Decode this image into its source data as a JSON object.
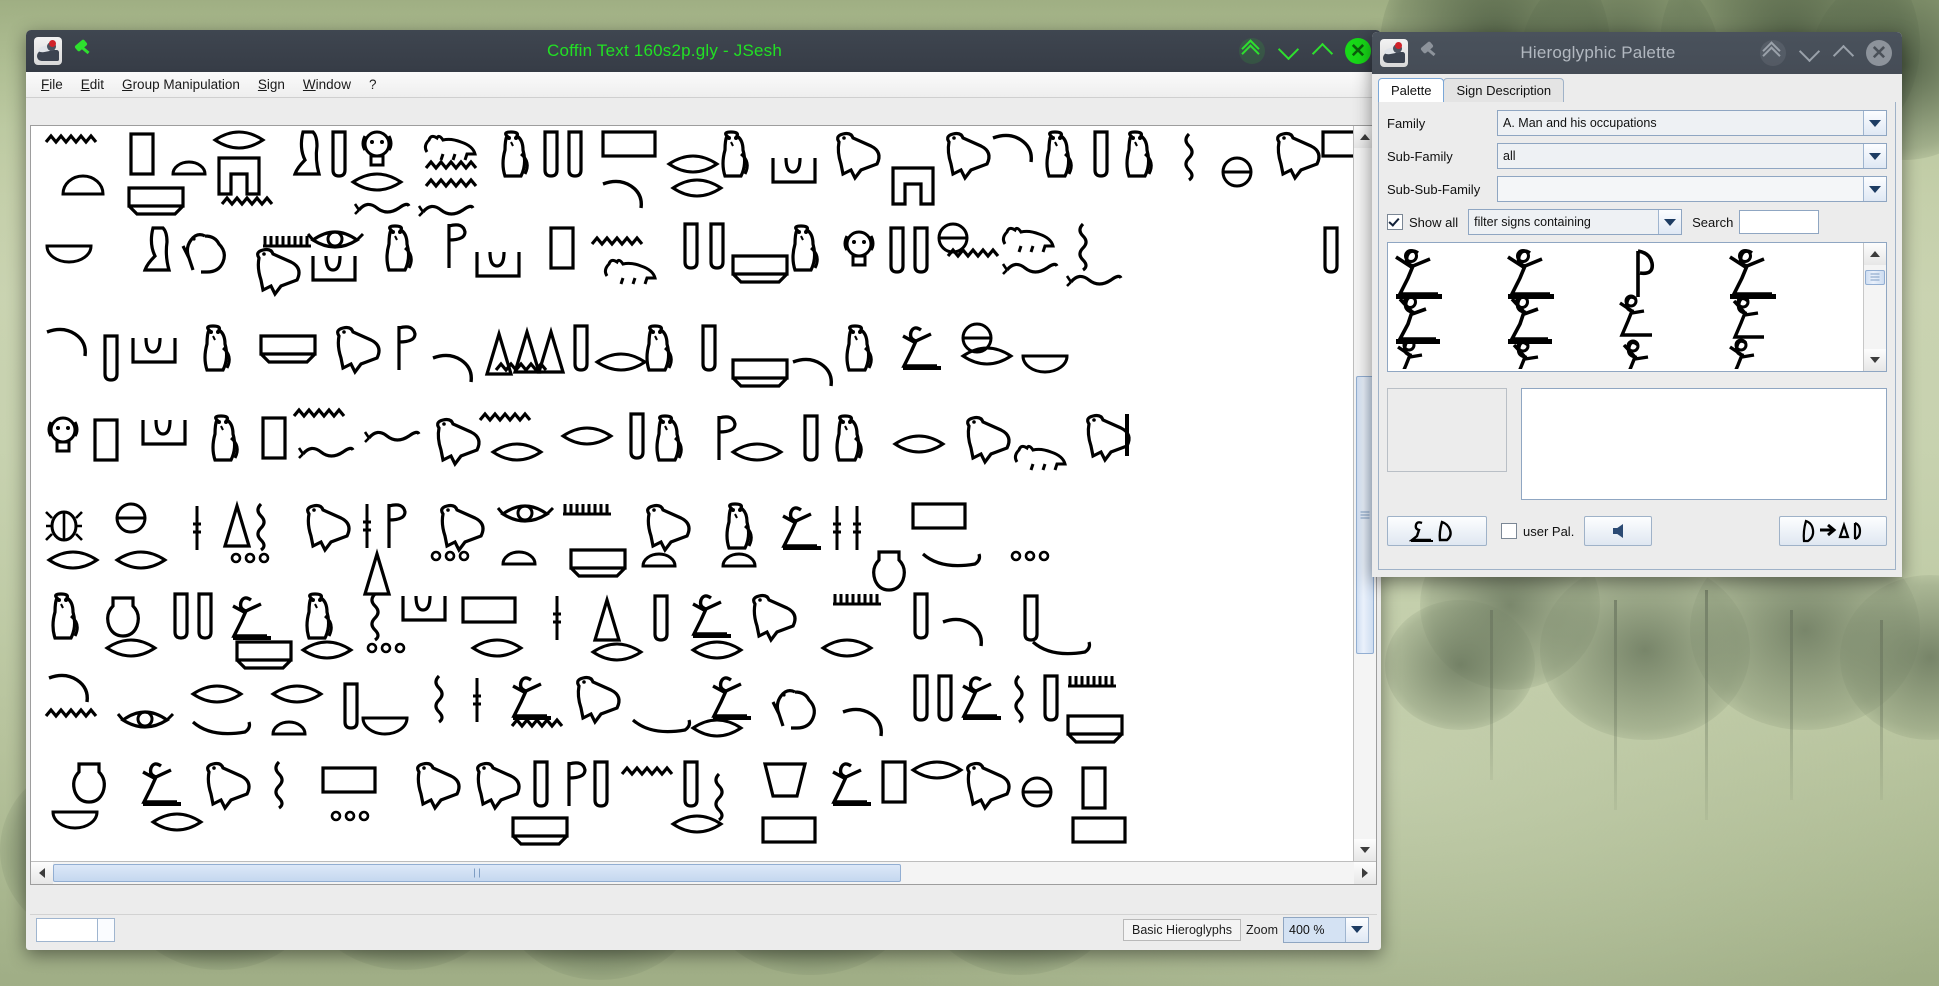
{
  "desktop": {
    "wallpaper_description": "hazy sage-green lake photo with dark pine trees along the top"
  },
  "jsesh_window": {
    "title": "Coffin Text 160s2p.gly - JSesh",
    "icon_name": "jsesh-app-icon",
    "pin_icon": "pin-icon",
    "active": true,
    "window_buttons": [
      {
        "name": "shade-button",
        "glyph": "double-chevron-up-icon"
      },
      {
        "name": "minimize-button",
        "glyph": "chevron-down-icon"
      },
      {
        "name": "maximize-button",
        "glyph": "chevron-up-icon"
      },
      {
        "name": "close-button",
        "glyph": "close-icon",
        "label": "✕"
      }
    ],
    "menu": [
      {
        "label": "File",
        "mnemonic": "F"
      },
      {
        "label": "Edit",
        "mnemonic": "E"
      },
      {
        "label": "Group Manipulation",
        "mnemonic": "G"
      },
      {
        "label": "Sign",
        "mnemonic": "S"
      },
      {
        "label": "Window",
        "mnemonic": "W"
      },
      {
        "label": "?",
        "mnemonic": ""
      }
    ],
    "statusbar": {
      "coordinate_field_value": "",
      "mode_label": "Basic Hieroglyphs",
      "zoom_label": "Zoom",
      "zoom_value": "400 %"
    },
    "scrollbars": {
      "vertical": {
        "thumb_top_pct": 33,
        "thumb_height_pct": 40
      },
      "horizontal": {
        "thumb_left_pct": 0,
        "thumb_width_pct": 65
      }
    }
  },
  "palette_window": {
    "title": "Hieroglyphic Palette",
    "icon_name": "jsesh-app-icon",
    "pin_icon": "pin-icon",
    "active": false,
    "window_buttons": [
      {
        "name": "shade-button",
        "glyph": "double-chevron-up-icon"
      },
      {
        "name": "minimize-button",
        "glyph": "chevron-down-icon"
      },
      {
        "name": "maximize-button",
        "glyph": "chevron-up-icon"
      },
      {
        "name": "close-button",
        "glyph": "close-icon",
        "label": "✕"
      }
    ],
    "tabs": [
      {
        "label": "Palette",
        "active": true
      },
      {
        "label": "Sign Description",
        "active": false
      }
    ],
    "fields": {
      "family_label": "Family",
      "family_value": "A. Man and his occupations",
      "subfamily_label": "Sub-Family",
      "subfamily_value": "all",
      "subsubfamily_label": "Sub-Sub-Family",
      "subsubfamily_value": "",
      "show_all_label": "Show all",
      "show_all_checked": true,
      "filter_value": "filter signs containing",
      "search_label": "Search",
      "search_value": ""
    },
    "sign_grid": {
      "columns": 4,
      "rows": 3,
      "signs": [
        "A1-variant-seated-man-arm",
        "A1-variant-seated-man-arm-2",
        "A2-staff-loop",
        "A1-variant-seated-man-arm-3",
        "A2-man-hand-to-mouth",
        "A2-man-hand-to-mouth-2",
        "A3-seated-man-small",
        "A4-man-arms-raised",
        "A5-man-hiding",
        "A6-man-bent-arms",
        "A7-man-arms-forward",
        "A8-man-leaning"
      ],
      "scroll_thumb_top_pct": 6
    },
    "bottom": {
      "palette_button_icon": "hieroglyph-pair-icon",
      "user_pal_label": "user Pal.",
      "user_pal_checked": false,
      "back_button_icon": "arrow-left-icon",
      "insert_button_icon": "hieroglyph-insert-icon"
    }
  }
}
